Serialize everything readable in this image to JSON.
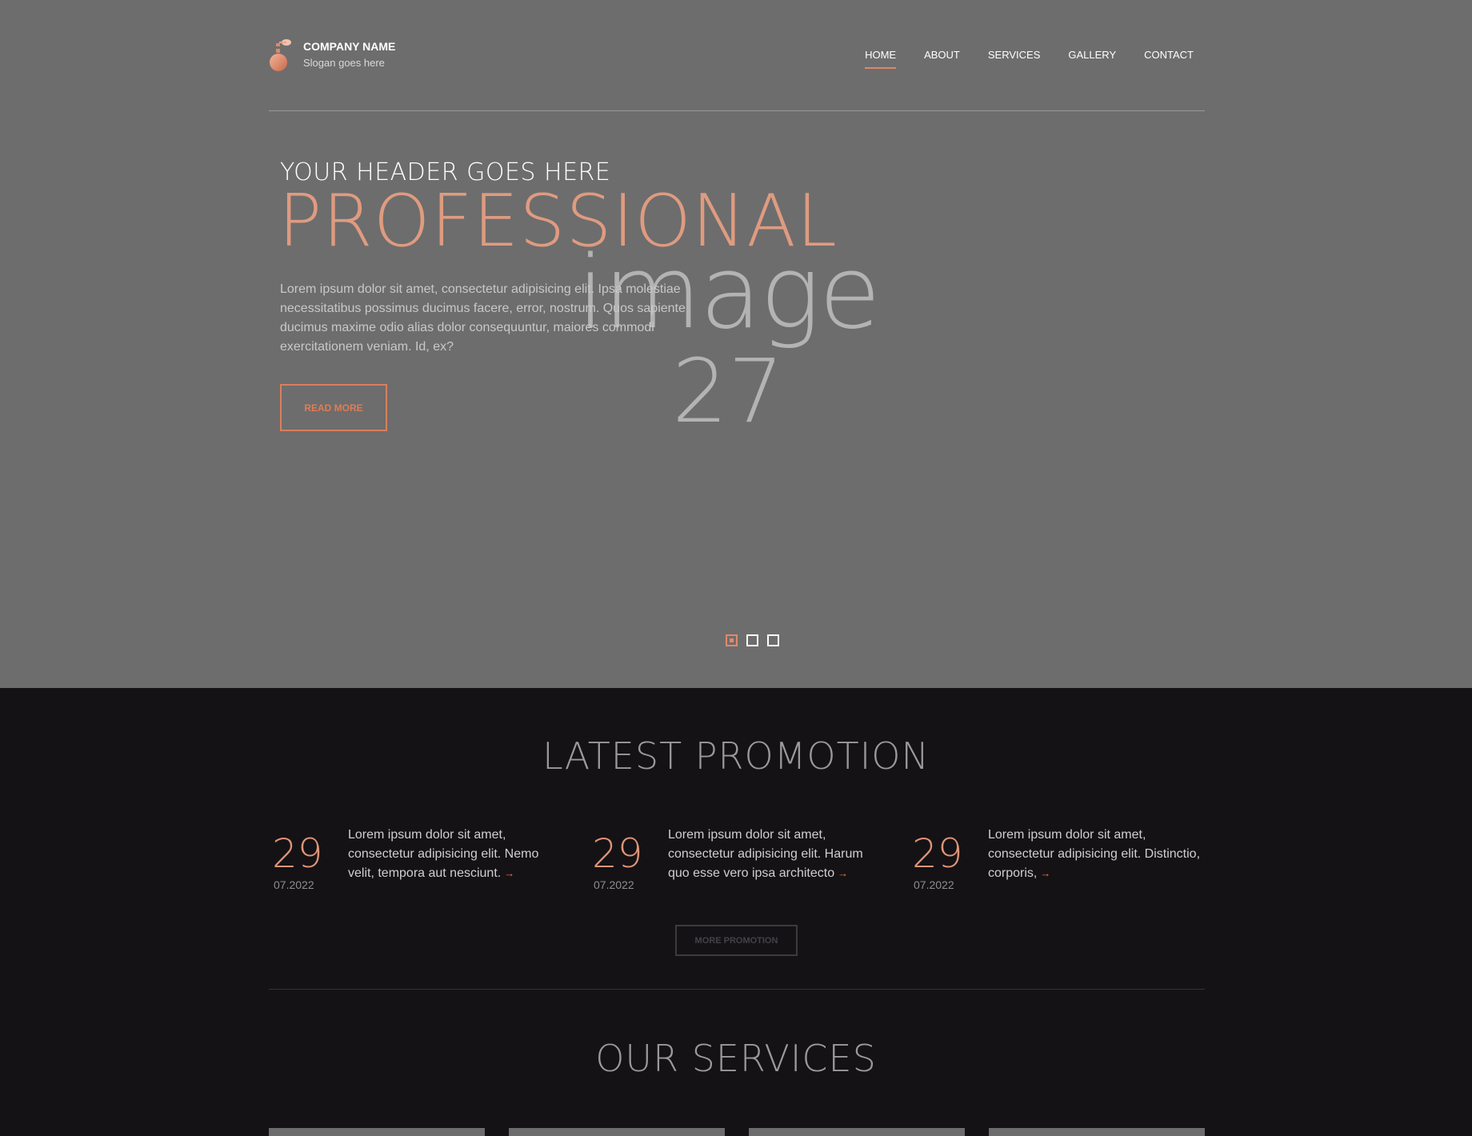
{
  "brand": {
    "company": "COMPANY NAME",
    "slogan": "Slogan goes here"
  },
  "nav": [
    {
      "label": "HOME",
      "active": true
    },
    {
      "label": "ABOUT",
      "active": false
    },
    {
      "label": "SERVICES",
      "active": false
    },
    {
      "label": "GALLERY",
      "active": false
    },
    {
      "label": "CONTACT",
      "active": false
    }
  ],
  "hero": {
    "subtitle": "YOUR HEADER GOES HERE",
    "title": "PROFESSIONAL",
    "text": "Lorem ipsum dolor sit amet, consectetur adipisicing elit. Ipsa molestiae necessitatibus possimus ducimus facere, error, nostrum. Quos sapiente ducimus maxime odio alias dolor consequuntur, maiores commodi exercitationem veniam. Id, ex?",
    "button": "READ MORE",
    "placeholder_line1": "image",
    "placeholder_line2": "27",
    "slides": 3,
    "active_slide": 1
  },
  "promotion": {
    "title": "LATEST PROMOTION",
    "items": [
      {
        "day": "29",
        "month": "07.2022",
        "text": "Lorem ipsum dolor sit amet, consectetur adipisicing elit. Nemo velit, tempora aut nesciunt.",
        "arrow": "→"
      },
      {
        "day": "29",
        "month": "07.2022",
        "text": "Lorem ipsum dolor sit amet, consectetur adipisicing elit. Harum quo esse vero ipsa architecto",
        "arrow": "→"
      },
      {
        "day": "29",
        "month": "07.2022",
        "text": "Lorem ipsum dolor sit amet, consectetur adipisicing elit. Distinctio, corporis,",
        "arrow": "→"
      }
    ],
    "more_button": "MORE PROMOTION"
  },
  "services": {
    "title": "OUR SERVICES"
  },
  "colors": {
    "accent": "#df9478",
    "hero_bg": "#6d6d6d",
    "page_bg": "#141215"
  }
}
